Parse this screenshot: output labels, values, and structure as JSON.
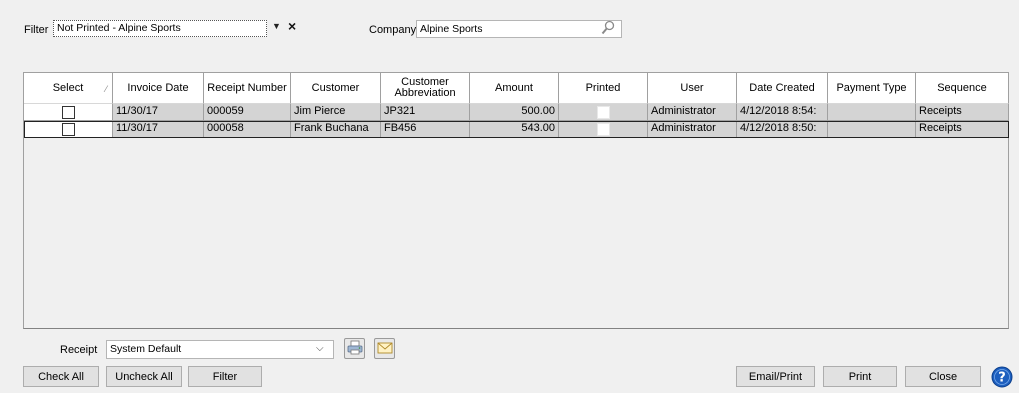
{
  "filter": {
    "label": "Filter",
    "value": "Not Printed - Alpine Sports",
    "clear_symbol": "×"
  },
  "company": {
    "label": "Company",
    "value": "Alpine Sports"
  },
  "grid": {
    "columns": [
      "Select",
      "Invoice Date",
      "Receipt Number",
      "Customer",
      "Customer Abbreviation",
      "Amount",
      "Printed",
      "User",
      "Date Created",
      "Payment Type",
      "Sequence"
    ],
    "rows": [
      {
        "select": false,
        "invoice_date": "11/30/17",
        "receipt_number": "000059",
        "customer": "Jim Pierce",
        "customer_abbreviation": "JP321",
        "amount": "500.00",
        "printed": false,
        "user": "Administrator",
        "date_created": "4/12/2018 8:54:",
        "payment_type": "",
        "sequence": "Receipts"
      },
      {
        "select": false,
        "invoice_date": "11/30/17",
        "receipt_number": "000058",
        "customer": "Frank Buchana",
        "customer_abbreviation": "FB456",
        "amount": "543.00",
        "printed": false,
        "user": "Administrator",
        "date_created": "4/12/2018 8:50:",
        "payment_type": "",
        "sequence": "Receipts"
      }
    ]
  },
  "receipt": {
    "label": "Receipt",
    "value": "System Default"
  },
  "buttons": {
    "check_all": "Check All",
    "uncheck_all": "Uncheck All",
    "filter": "Filter",
    "email_print": "Email/Print",
    "print": "Print",
    "close": "Close"
  },
  "icons": {
    "search": "search-icon",
    "printer": "printer-icon",
    "email": "email-icon",
    "help": "help-icon"
  },
  "colors": {
    "row_background": "#d4d4d4",
    "help_blue": "#1d5fbf"
  }
}
